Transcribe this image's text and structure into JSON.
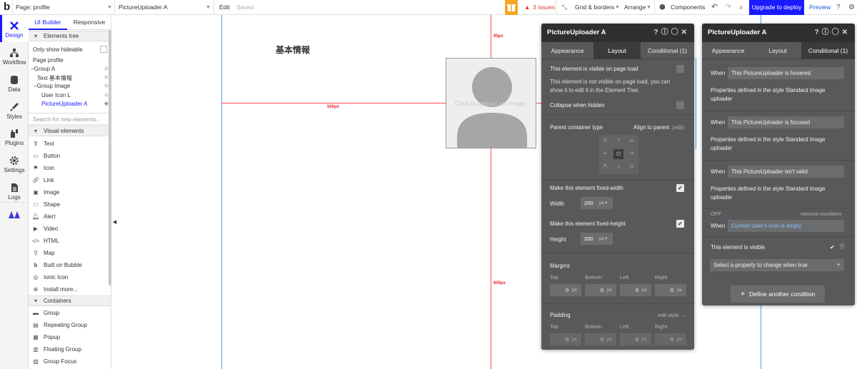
{
  "topbar": {
    "logo": "b",
    "page_label": "Page: profile",
    "element_label": "PictureUploader A",
    "edit": "Edit",
    "saved": "Saved",
    "issues": "3 issues",
    "grid": "Grid & borders",
    "arrange": "Arrange",
    "components": "Components",
    "upgrade": "Upgrade to deploy",
    "preview": "Preview",
    "upgrade_color": "#1a1aff"
  },
  "rail": [
    {
      "label": "Design",
      "icon": "design-icon"
    },
    {
      "label": "Workflow",
      "icon": "workflow-icon"
    },
    {
      "label": "Data",
      "icon": "data-icon"
    },
    {
      "label": "Styles",
      "icon": "styles-icon"
    },
    {
      "label": "Plugins",
      "icon": "plugins-icon"
    },
    {
      "label": "Settings",
      "icon": "settings-icon"
    },
    {
      "label": "Logs",
      "icon": "logs-icon"
    }
  ],
  "panel": {
    "tab_builder": "UI Builder",
    "tab_responsive": "Responsive",
    "elements_tree": "Elements tree",
    "only_hideable": "Only show hideable",
    "tree": [
      "Page profile",
      "Group A",
      "Text 基本情報",
      "Group Image",
      "User Icon L",
      "PictureUploader A"
    ],
    "search_placeholder": "Search for new elements...",
    "visual_elements": "Visual elements",
    "visual": [
      "Text",
      "Button",
      "Icon",
      "Link",
      "Image",
      "Shape",
      "Alert",
      "Video",
      "HTML",
      "Map",
      "Built on Bubble",
      "Ionic Icon",
      "Install more..."
    ],
    "containers": "Containers",
    "container_items": [
      "Group",
      "Repeating Group",
      "Popup",
      "Floating Group",
      "Group Focus"
    ]
  },
  "canvas": {
    "heading": "基本情報",
    "upload_text": "Click to upload an image",
    "ruler_95": "95px",
    "ruler_500": "500px",
    "ruler_605": "605px"
  },
  "editor_layout": {
    "title": "PictureUploader A",
    "tabs": [
      "Appearance",
      "Layout",
      "Conditional (1)"
    ],
    "visible_label": "This element is visible on page load",
    "visible_note_1": "This element is not visible on page load, you can",
    "visible_note_2": "show it to edit it in the Element Tree.",
    "collapse_label": "Collapse when hidden",
    "parent_type": "Parent container type",
    "align_parent": "Align to parent",
    "align_edit": "(edit)",
    "fixed_width": "Make this element fixed-width",
    "width_label": "Width",
    "width_value": "200",
    "fixed_height": "Make this element fixed-height",
    "height_label": "Height",
    "height_value": "200",
    "unit": "px",
    "margins": "Margins",
    "padding": "Padding",
    "edit_style": "edit style →",
    "sides": [
      "Top",
      "Bottom",
      "Left",
      "Right"
    ],
    "zero": "0"
  },
  "editor_conditional": {
    "title": "PictureUploader A",
    "tabs": [
      "Appearance",
      "Layout",
      "Conditional (1)"
    ],
    "when": "When",
    "conds": [
      {
        "cond": "This PictureUploader is hovered",
        "props_1": "Properties defined in the style Standard Image",
        "props_2": "uploader"
      },
      {
        "cond": "This PictureUploader is focused",
        "props_1": "Properties defined in the style Standard Image",
        "props_2": "uploader"
      },
      {
        "cond": "This PictureUploader isn't valid",
        "props_1": "Properties defined in the style Standard Image",
        "props_2": "uploader"
      }
    ],
    "off": "OFF",
    "remove": "remove condition",
    "user_cond": "Current User's Icon is empty",
    "visible_prop": "This element is visible",
    "select_prop": "Select a property to change when true",
    "define": "Define another condition"
  }
}
